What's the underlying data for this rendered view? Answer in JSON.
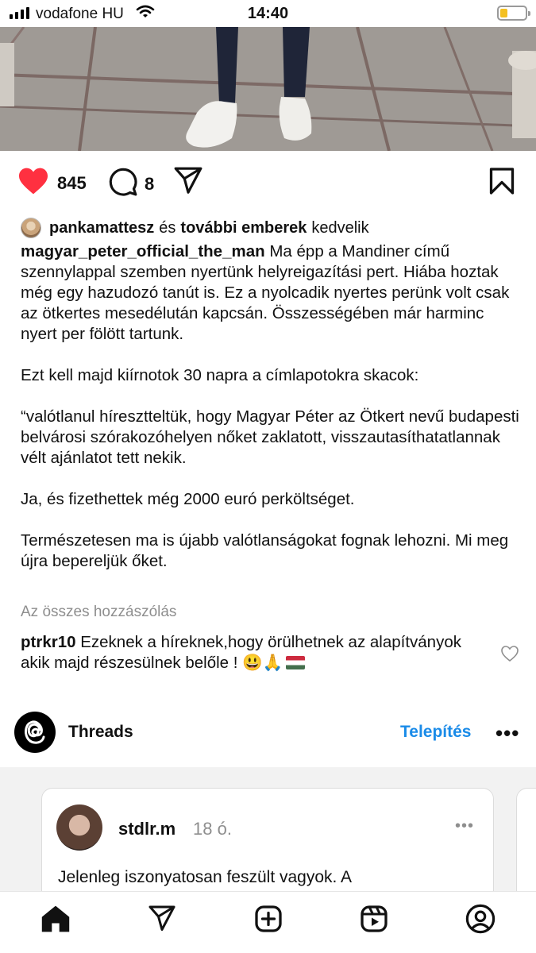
{
  "status_bar": {
    "carrier": "vodafone HU",
    "time": "14:40"
  },
  "post": {
    "likes_count": "845",
    "comments_count": "8",
    "liked_by": {
      "first_user": "pankamattesz",
      "connector": "és",
      "others": "további emberek",
      "suffix": "kedvelik"
    },
    "caption": {
      "username": "magyar_peter_official_the_man",
      "paragraphs": [
        "Ma épp a Mandiner című szennylappal szemben nyertünk helyreigazítási pert. Hiába hoztak még egy hazudozó tanút is. Ez a nyolcadik nyertes perünk volt csak az ötkertes mesedélután kapcsán. Összességében már harminc nyert per fölött tartunk.",
        "Ezt kell majd kiírnotok 30 napra a címlapotokra skacok:",
        "“valótlanul híresztteltük, hogy Magyar Péter az Ötkert nevű budapesti belvárosi szórakozóhelyen nőket zaklatott, visszautasíthatatlannak vélt ajánlatot tett nekik.",
        "Ja, és fizethettek még 2000 euró perköltséget.",
        "Természetesen ma is újabb valótlanságokat fognak lehozni. Mi meg újra bepereljük őket."
      ]
    },
    "view_all_comments": "Az összes hozzászólás",
    "top_comment": {
      "username": "ptrkr10",
      "text": "Ezeknek a híreknek,hogy örülhetnek az alapítványok akik majd részesülnek belőle !",
      "emojis": "😃🙏"
    }
  },
  "threads": {
    "label": "Threads",
    "install": "Telepítés",
    "more": "•••",
    "card": {
      "username": "stdlr.m",
      "time": "18 ó.",
      "more": "•••",
      "text": "Jelenleg iszonyatosan feszült vagyok. A"
    }
  },
  "icons": {
    "like": "heart-filled-icon",
    "comment": "comment-bubble-icon",
    "share": "paper-plane-icon",
    "save": "bookmark-icon",
    "nav": [
      "home-icon",
      "send-icon",
      "create-icon",
      "reels-icon",
      "profile-icon"
    ]
  },
  "colors": {
    "like_red": "#ff3040",
    "link_blue": "#1a8be8",
    "muted_gray": "#8e8e8e"
  }
}
